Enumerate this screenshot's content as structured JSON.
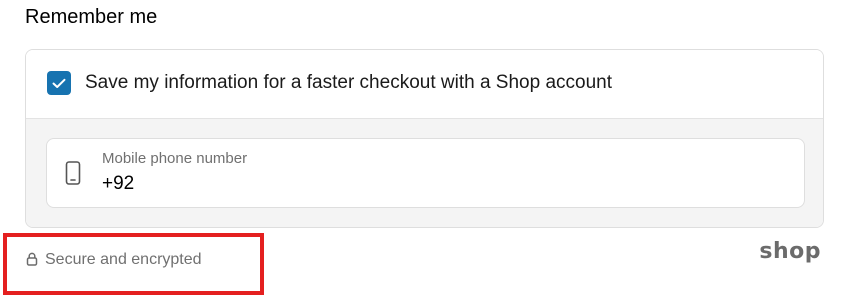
{
  "section": {
    "title": "Remember me"
  },
  "save_info": {
    "checked": true,
    "label": "Save my information for a faster checkout with a Shop account",
    "checkbox_color": "#1773b0"
  },
  "phone": {
    "label": "Mobile phone number",
    "value": "+92",
    "icon": "mobile-phone-icon"
  },
  "footer": {
    "secure_text": "Secure and encrypted",
    "lock_icon": "lock-icon",
    "brand": "shop",
    "highlight_color": "#e41f1f"
  }
}
